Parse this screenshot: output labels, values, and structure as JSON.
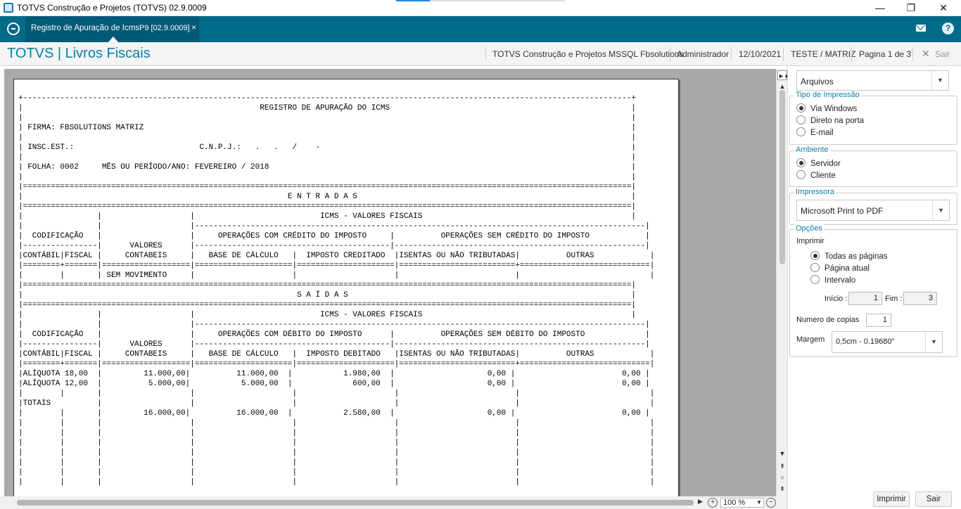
{
  "window": {
    "title": "TOTVS Construção e Projetos (TOTVS) 02.9.0009",
    "minimize": "—",
    "restore": "❐",
    "close": "✕"
  },
  "appbar": {
    "tab_label": "Registro de Apuração de Icms",
    "tab_version": "P9 [02.9.0009]",
    "tab_close": "×",
    "help": "?"
  },
  "header": {
    "brand": "TOTVS | Livros Fiscais",
    "company": "TOTVS Construção e Projetos MSSQL Fbsolutions",
    "user": "Administrador",
    "date": "12/10/2021",
    "branch": "TESTE / MATRIZ",
    "page": "Pagina 1 de 3",
    "exit": "Sair"
  },
  "report": {
    "lines": [
      "+-----------------------------------------------------------------------------------------------------------------------------------+",
      "|                                                   REGISTRO DE APURAÇÃO DO ICMS                                                    |",
      "|                                                                                                                                   |",
      "| FIRMA: FBSOLUTIONS MATRIZ                                                                                                         |",
      "|                                                                                                                                   |",
      "| INSC.EST.:                           C.N.P.J.:   .   .   /    -                                                                   |",
      "|                                                                                                                                   |",
      "| FOLHA: 0002     MÊS OU PERÍODO/ANO: FEVEREIRO / 2018                                                                              |",
      "|                                                                                                                                   |",
      "|===================================================================================================================================|",
      "|                                                         E N T R A D A S                                                           |",
      "|===================================================================================================================================|",
      "|                |                   |                           ICMS - VALORES FISCAIS                                             |",
      "|                |                   |-------------------------------------------------------------------------------------------------|",
      "|  CODIFICAÇÃO   |                   |     OPERAÇÕES COM CRÉDITO DO IMPOSTO     |          OPERAÇÕES SEM CRÉDITO DO IMPOSTO            |",
      "|----------------|      VALORES      |------------------------------------------|------------------------------------------------------|",
      "|CONTÁBIL|FISCAL |     CONTABEIS     |   BASE DE CÁLCULO   |  IMPOSTO CREDITADO  |ISENTAS OU NÃO TRIBUTADAS|          OUTRAS            |",
      "|========+=======|===================|=====================|=====================|=========================+============================|",
      "|        |       | SEM MOVIMENTO     |                     |                     |                         |                            |",
      "|===================================================================================================================================|",
      "|                                                           S A Í D A S                                                             |",
      "|===================================================================================================================================|",
      "|                |                   |                           ICMS - VALORES FISCAIS                                             |",
      "|                |                   |-------------------------------------------------------------------------------------------------|",
      "|  CODIFICAÇÃO   |                   |     OPERAÇÕES COM DÉBITO DO IMPOSTO      |          OPERAÇÕES SEM DÉBITO DO IMPOSTO             |",
      "|----------------|      VALORES      |------------------------------------------|------------------------------------------------------|",
      "|CONTÁBIL|FISCAL |     CONTABEIS     |   BASE DE CÁLCULO   |  IMPOSTO DEBITADO   |ISENTAS OU NÃO TRIBUTADAS|          OUTRAS            |",
      "|========+=======|===================|=====================|=====================|=========================+============================|",
      "|ALÍQUOTA 18,00  |         11.000,00|          11.000,00  |           1.980,00  |                    0,00 |                       0,00 |",
      "|ALÍQUOTA 12,00  |          5.000,00|           5.000,00  |             600,00  |                    0,00 |                       0,00 |",
      "|        |       |                   |                     |                     |                         |                            |",
      "|TOTAIS          |                   |                     |                     |                         |                            |",
      "|        |       |         16.000,00|          16.000,00  |           2.580,00  |                    0,00 |                       0,00 |",
      "|        |       |                   |                     |                     |                         |                            |",
      "|        |       |                   |                     |                     |                         |                            |",
      "|        |       |                   |                     |                     |                         |                            |",
      "|        |       |                   |                     |                     |                         |                            |",
      "|        |       |                   |                     |                     |                         |                            |",
      "|        |       |                   |                     |                     |                         |                            |",
      "|        |       |                   |                     |                     |                         |                            |"
    ]
  },
  "zoom": {
    "value": "100 %"
  },
  "panel": {
    "destino": "Arquivos",
    "tipo_impressao": {
      "legend": "Tipo de Impressão",
      "options": [
        "Via Windows",
        "Direto na porta",
        "E-mail"
      ],
      "selected": 0
    },
    "ambiente": {
      "legend": "Ambiente",
      "options": [
        "Servidor",
        "Cliente"
      ],
      "selected": 0
    },
    "impressora": {
      "legend": "Impressora",
      "value": "Microsoft Print to PDF"
    },
    "opcoes": {
      "legend": "Opções",
      "imprimir_label": "Imprimir",
      "options": [
        "Todas as páginas",
        "Página atual",
        "Intervalo"
      ],
      "selected": 0,
      "inicio_label": "Início :",
      "inicio_value": "1",
      "fim_label": "Fim :",
      "fim_value": "3",
      "copias_label": "Numero de copias",
      "copias_value": "1",
      "margem_label": "Margem",
      "margem_value": "0,5cm - 0.19680\""
    },
    "print_button": "Imprimir",
    "exit_button": "Sair"
  }
}
